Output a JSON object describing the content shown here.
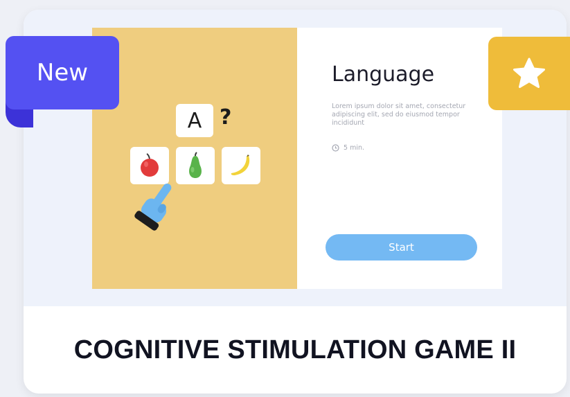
{
  "badge_new": "New",
  "favorite": {
    "icon": "star-icon"
  },
  "preview": {
    "letter": "A",
    "question": "?",
    "fruits": [
      "apple-icon",
      "pear-icon",
      "banana-icon"
    ],
    "title": "Language",
    "description": "Lorem ipsum dolor sit amet, consectetur adipiscing elit, sed do eiusmod tempor incididunt",
    "time": "5 min.",
    "start_label": "Start"
  },
  "game_title": "COGNITIVE STIMULATION GAME II",
  "colors": {
    "badge_new": "#5451f2",
    "badge_new_tail": "#3c32d8",
    "badge_favorite": "#efbc3a",
    "preview_left_bg": "#efcd7f",
    "start_button": "#74b9f3"
  }
}
